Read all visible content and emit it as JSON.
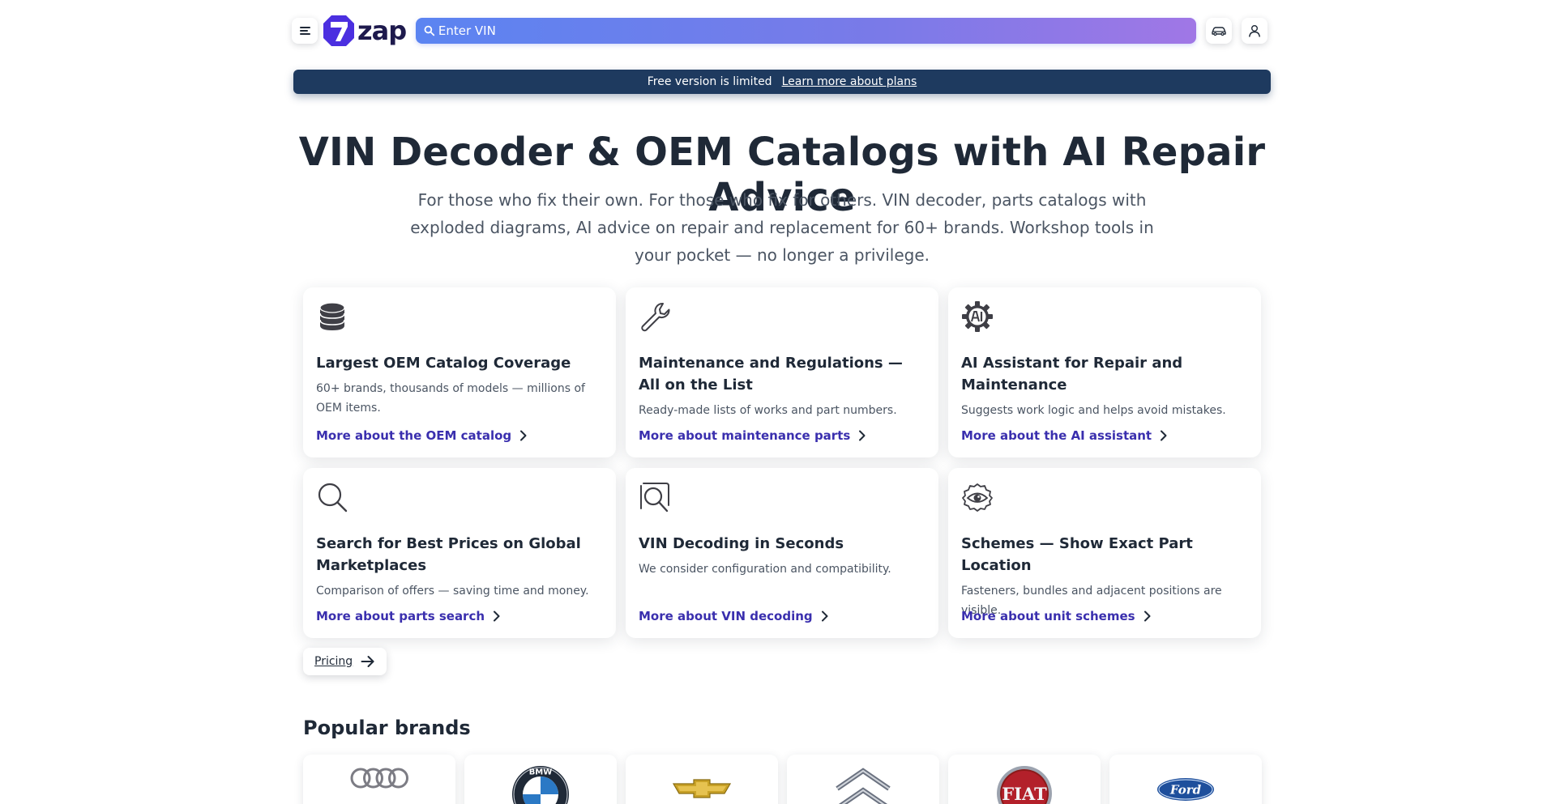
{
  "header": {
    "logo_text": "zap",
    "search_placeholder": "Enter VIN"
  },
  "banner": {
    "text": "Free version is limited",
    "link": "Learn more about plans"
  },
  "hero": {
    "title": "VIN Decoder & OEM Catalogs with AI Repair Advice",
    "subtitle": "For those who fix their own. For those who fix for others. VIN decoder, parts catalogs with exploded diagrams, AI advice on repair and replacement for 60+ brands. Workshop tools in your pocket — no longer a privilege."
  },
  "cards": [
    {
      "icon": "database-icon",
      "title": "Largest OEM Catalog Coverage",
      "desc": "60+ brands, thousands of models — millions of OEM items.",
      "link": "More about the OEM catalog"
    },
    {
      "icon": "wrench-icon",
      "title": "Maintenance and Regulations — All on the List",
      "desc": "Ready-made lists of works and part numbers.",
      "link": "More about maintenance parts"
    },
    {
      "icon": "ai-gear-icon",
      "title": "AI Assistant for Repair and Maintenance",
      "desc": "Suggests work logic and helps avoid mistakes.",
      "link": "More about the AI assistant"
    },
    {
      "icon": "search-icon",
      "title": "Search for Best Prices on Global Marketplaces",
      "desc": "Comparison of offers — saving time and money.",
      "link": "More about parts search"
    },
    {
      "icon": "vin-search-icon",
      "title": "VIN Decoding in Seconds",
      "desc": "We consider configuration and compatibility.",
      "link": "More about VIN decoding"
    },
    {
      "icon": "eye-scheme-icon",
      "title": "Schemes — Show Exact Part Location",
      "desc": "Fasteners, bundles and adjacent positions are visible.",
      "link": "More about unit schemes"
    }
  ],
  "pricing": {
    "label": "Pricing"
  },
  "brands": {
    "title": "Popular brands",
    "items": [
      {
        "icon": "audi-logo"
      },
      {
        "icon": "bmw-logo",
        "logo_text": "BMW"
      },
      {
        "icon": "chevrolet-logo"
      },
      {
        "icon": "citroen-logo"
      },
      {
        "icon": "fiat-logo",
        "logo_text": "FIAT"
      },
      {
        "icon": "ford-logo",
        "logo_text": "Ford"
      }
    ]
  },
  "colors": {
    "accent_link": "#3a2fae",
    "banner_bg": "#1e3a5f",
    "search_gradient_start": "#5b84f1",
    "search_gradient_end": "#a077e6"
  }
}
